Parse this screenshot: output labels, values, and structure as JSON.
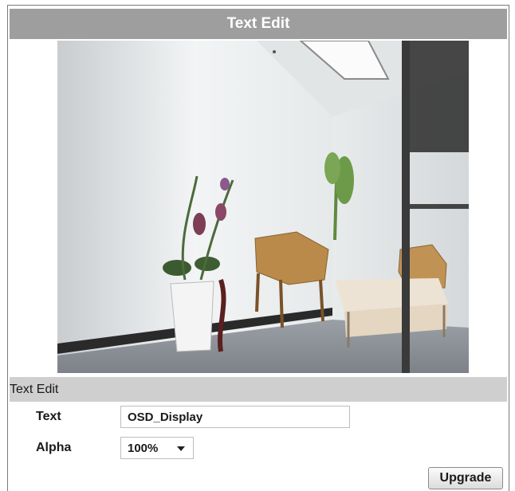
{
  "header": {
    "title": "Text Edit"
  },
  "section": {
    "title": "Text Edit"
  },
  "form": {
    "text_label": "Text",
    "text_value": "OSD_Display",
    "alpha_label": "Alpha",
    "alpha_value": "100%"
  },
  "actions": {
    "upgrade_label": "Upgrade"
  },
  "icons": {
    "select_caret": "chevron-down-icon"
  },
  "colors": {
    "title_bar": "#9e9e9e",
    "section_bar": "#cfcfcf",
    "frame_border": "#7a7a7a"
  }
}
